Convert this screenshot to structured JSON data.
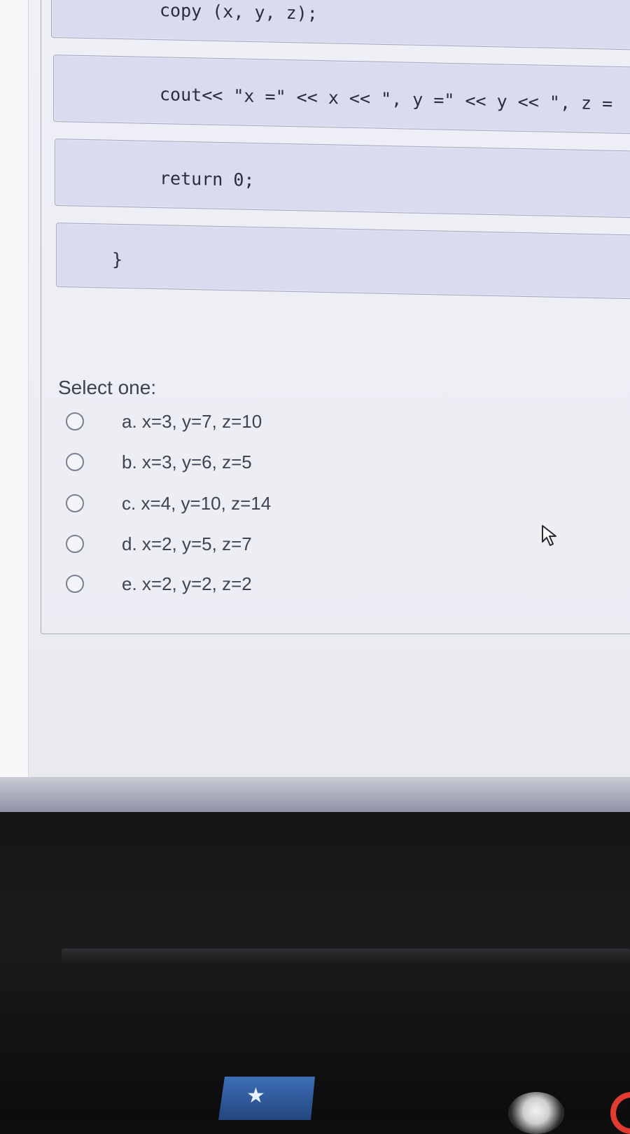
{
  "code": {
    "lines": [
      "copy (x, y, z);",
      "cout<< \"x =\" << x << \", y =\" << y << \", z =",
      "return 0;",
      "}"
    ]
  },
  "question": {
    "prompt": "Select one:",
    "options": [
      {
        "label": "a. x=3, y=7, z=10",
        "selected": false
      },
      {
        "label": "b. x=3, y=6, z=5",
        "selected": false
      },
      {
        "label": "c. x=4, y=10, z=14",
        "selected": false
      },
      {
        "label": "d. x=2, y=5, z=7",
        "selected": false
      },
      {
        "label": "e. x=2, y=2, z=2",
        "selected": false
      }
    ]
  },
  "icons": {
    "pointer": "mouse-pointer-icon",
    "taskbar": [
      "star-icon",
      "app-icon",
      "red-circle-icon"
    ]
  },
  "taskbar": {
    "star_glyph": "★"
  },
  "colors": {
    "code_bg": "#d9dcef",
    "text": "#3f4352",
    "screen_bg": "#eceef2",
    "bezel": "#151516",
    "taskbar_blue": "#3e6fb8",
    "taskbar_red": "#e23b2f"
  }
}
